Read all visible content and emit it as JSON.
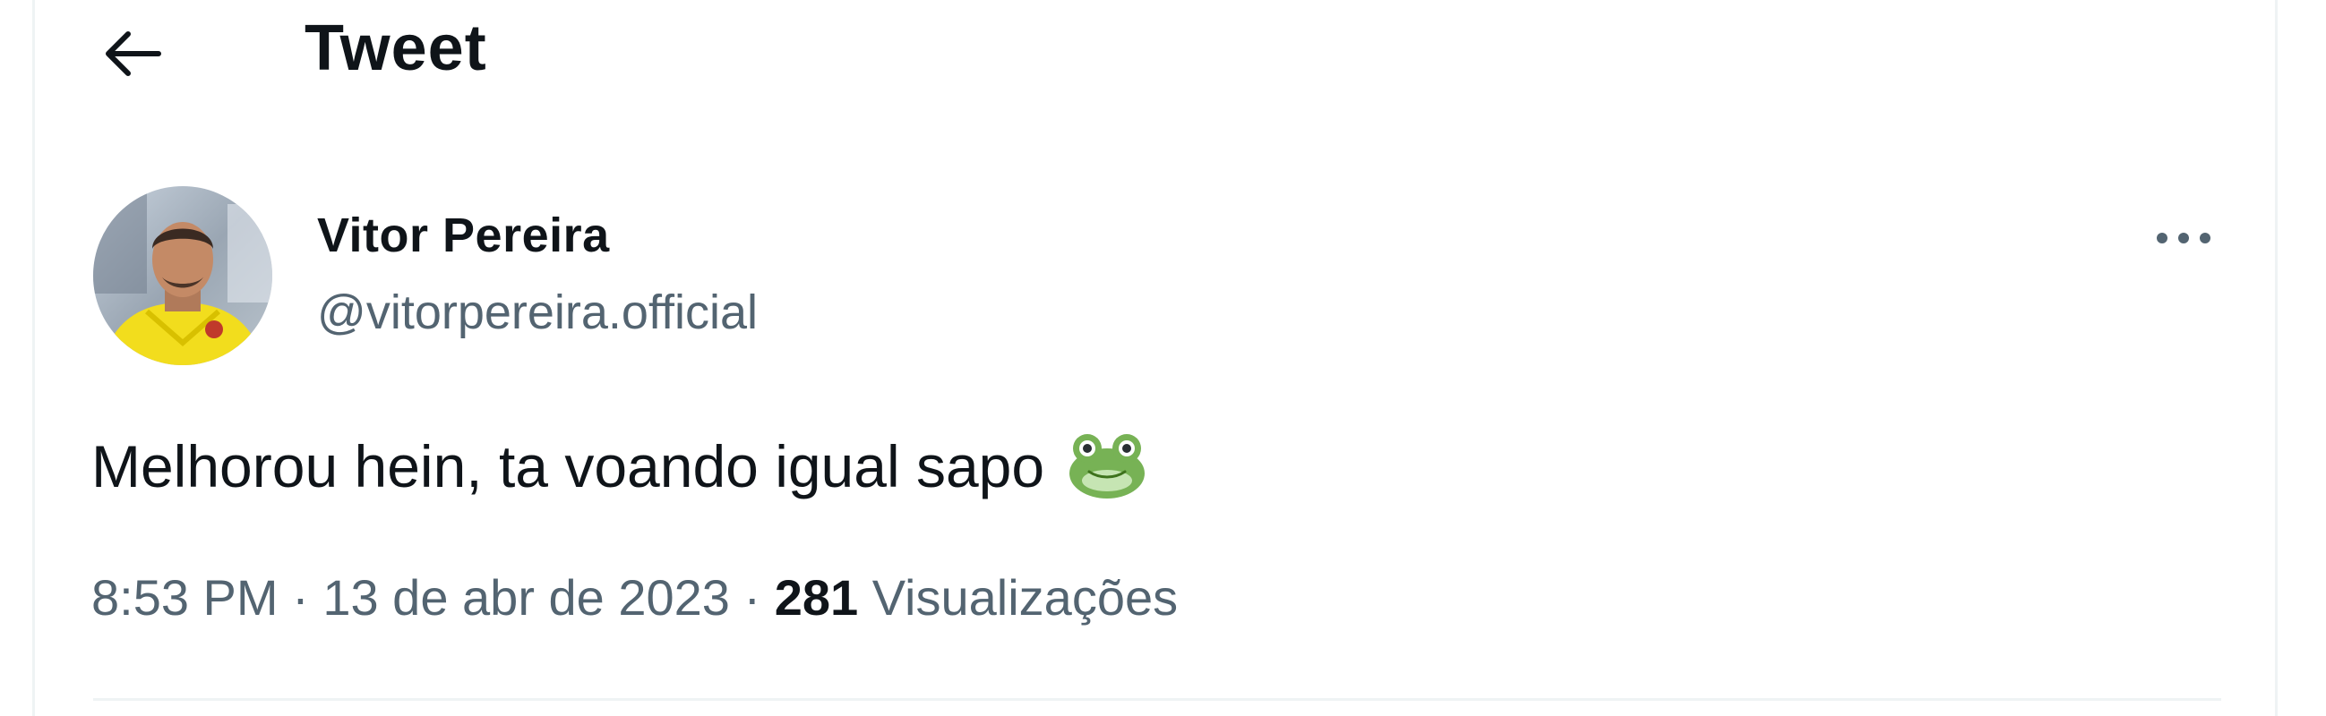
{
  "header": {
    "title": "Tweet",
    "back_icon": "arrow-left-icon"
  },
  "tweet": {
    "author": {
      "display_name": "Vitor Pereira",
      "handle": "@vitorpereira.official",
      "avatar": "profile-photo"
    },
    "text": "Melhorou hein, ta voando igual sapo",
    "emoji": "frog-emoji",
    "more_icon": "more-horizontal-icon",
    "meta": {
      "time": "8:53 PM",
      "separator1": " · ",
      "date": "13 de abr de 2023",
      "separator2": " · ",
      "views_count": "281",
      "views_label": " Visualizações"
    }
  },
  "colors": {
    "text_primary": "#0f1419",
    "text_secondary": "#536471",
    "border": "#eff3f4"
  }
}
